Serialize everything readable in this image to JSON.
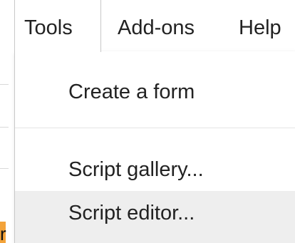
{
  "menubar": {
    "items": [
      {
        "label": "Tools",
        "active": true
      },
      {
        "label": "Add-ons"
      },
      {
        "label": "Help"
      }
    ]
  },
  "tools_menu": {
    "items": [
      {
        "label": "Create a form"
      },
      {
        "label": "Script gallery..."
      },
      {
        "label": "Script editor...",
        "hovered": true
      }
    ]
  },
  "colors": {
    "hover_background": "#eeeeee",
    "border": "#c8c8c8",
    "text": "#222222",
    "sheet_accent": "#f3a33a"
  }
}
